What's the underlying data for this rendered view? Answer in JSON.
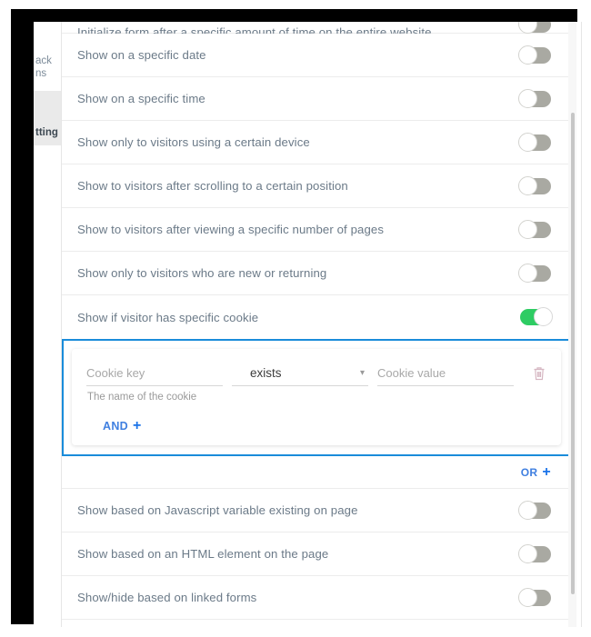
{
  "sidebar": {
    "items": [
      {
        "id": "feedback-forms",
        "line1": "ack",
        "line2": "ns",
        "selected": false
      },
      {
        "id": "setting",
        "line1": "tting",
        "line2": "",
        "selected": true
      }
    ]
  },
  "main": {
    "rows": [
      {
        "id": "initialize-form-after-time",
        "label": "Initialize form after a specific amount of time on the entire website",
        "toggle": "off",
        "clipped": true
      },
      {
        "id": "show-on-specific-date",
        "label": "Show on a specific date",
        "toggle": "off"
      },
      {
        "id": "show-on-specific-time",
        "label": "Show on a specific time",
        "toggle": "off"
      },
      {
        "id": "show-certain-device",
        "label": "Show only to visitors using a certain device",
        "toggle": "off"
      },
      {
        "id": "show-after-scrolling",
        "label": "Show to visitors after scrolling to a certain position",
        "toggle": "off"
      },
      {
        "id": "show-after-viewing-pages",
        "label": "Show to visitors after viewing a specific number of pages",
        "toggle": "off"
      },
      {
        "id": "show-new-or-returning",
        "label": "Show only to visitors who are new or returning",
        "toggle": "off"
      },
      {
        "id": "show-specific-cookie",
        "label": "Show if visitor has specific cookie",
        "toggle": "on"
      }
    ],
    "rows_after": [
      {
        "id": "show-javascript-variable",
        "label": "Show based on Javascript variable existing on page",
        "toggle": "off"
      },
      {
        "id": "show-html-element",
        "label": "Show based on an HTML element on the page",
        "toggle": "off"
      },
      {
        "id": "show-hide-linked-forms",
        "label": "Show/hide based on linked forms",
        "toggle": "off"
      }
    ]
  },
  "cookie_condition": {
    "key_placeholder": "Cookie key",
    "key_value": "",
    "operator_value": "exists",
    "value_placeholder": "Cookie value",
    "value_value": "",
    "helper_text": "The name of the cookie",
    "and_label": "AND",
    "and_plus": "+",
    "delete_tooltip": "Delete"
  },
  "or_row": {
    "label": "OR",
    "plus": "+"
  },
  "colors": {
    "accent_blue": "#1a8cda",
    "link_blue": "#3f7fe0",
    "toggle_on": "#2ecc63",
    "toggle_off": "#a9a9a2",
    "text": "#6b7a88"
  }
}
